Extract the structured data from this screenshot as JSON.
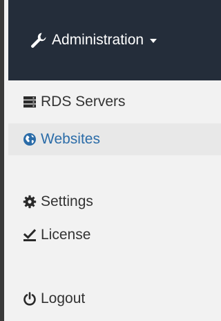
{
  "header": {
    "title": "Administration",
    "icon": "wrench-icon"
  },
  "menu": {
    "items": [
      {
        "label": "RDS Servers",
        "icon": "server-icon",
        "active": false
      },
      {
        "label": "Websites",
        "icon": "globe-icon",
        "active": true
      },
      {
        "label": "Settings",
        "icon": "gear-icon",
        "active": false
      },
      {
        "label": "License",
        "icon": "license-check-icon",
        "active": false
      },
      {
        "label": "Logout",
        "icon": "power-icon",
        "active": false
      }
    ]
  },
  "colors": {
    "header_bg": "#242d3a",
    "menu_bg": "#f2f2f2",
    "active_bg": "#e8e8e8",
    "active_text": "#2b6ca8",
    "text": "#333333"
  }
}
